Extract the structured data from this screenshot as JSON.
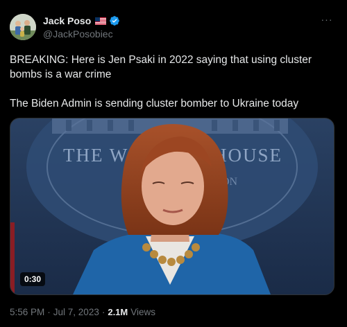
{
  "author": {
    "display_name": "Jack Poso",
    "handle": "@JackPosobiec",
    "flag_icon": "us-flag-icon",
    "verified_icon": "verified-badge-icon",
    "verified_color": "#1d9bf0"
  },
  "more_icon": "more-options-icon",
  "more_label": "···",
  "tweet_text": "BREAKING: Here is Jen Psaki in 2022 saying that using cluster bombs is a war crime\n\nThe Biden Admin is sending cluster bomber to Ukraine today",
  "media": {
    "backdrop_text_left": "THE W",
    "backdrop_text_right": "HOUSE",
    "backdrop_text_sub": "ON",
    "duration": "0:30"
  },
  "meta": {
    "time": "5:56 PM",
    "separator": "·",
    "date": "Jul 7, 2023",
    "separator2": "·",
    "views_count": "2.1M",
    "views_label": "Views"
  },
  "colors": {
    "background": "#000000",
    "text_primary": "#e7e9ea",
    "text_secondary": "#71767b",
    "border": "#2f3336"
  }
}
